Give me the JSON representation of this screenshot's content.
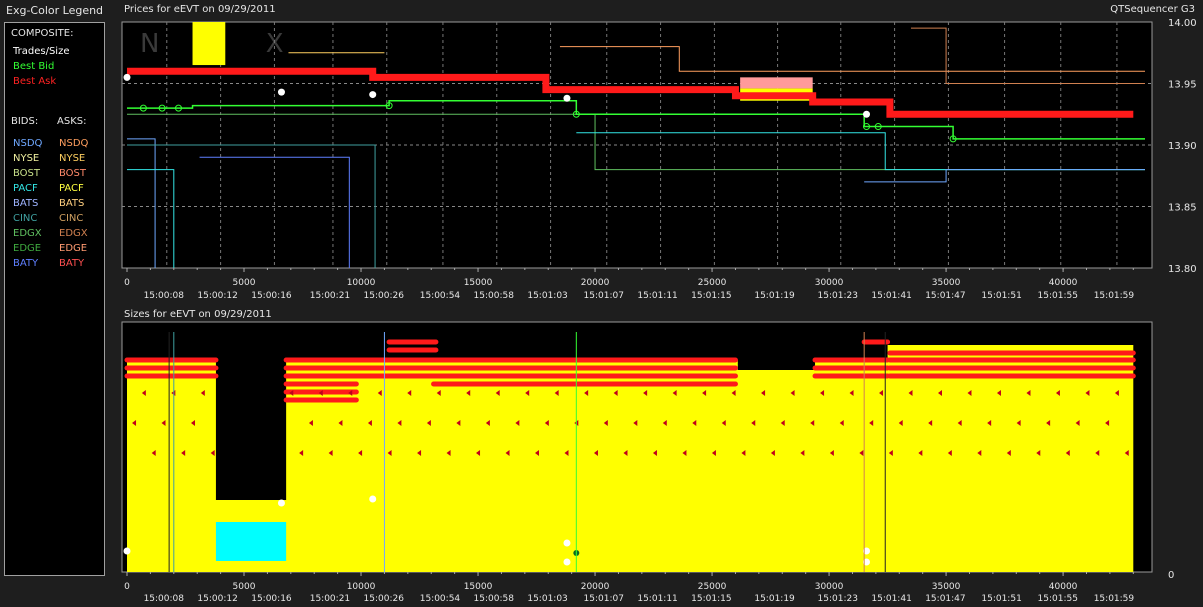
{
  "app_title": "QTSequencer G3",
  "legend": {
    "title": "Exg-Color Legend",
    "composite_header": "COMPOSITE:",
    "composite": [
      {
        "label": "Trades/Size",
        "color": "#ffffff"
      },
      {
        "label": "Best Bid",
        "color": "#33ff33"
      },
      {
        "label": "Best Ask",
        "color": "#ff2222"
      }
    ],
    "bids_header": "BIDS:",
    "asks_header": "ASKS:",
    "bids": [
      {
        "label": "NSDQ",
        "color": "#6fa8ff"
      },
      {
        "label": "NYSE",
        "color": "#f0f0a0"
      },
      {
        "label": "BOST",
        "color": "#c8e08a"
      },
      {
        "label": "PACF",
        "color": "#33e6e6"
      },
      {
        "label": "BATS",
        "color": "#9fb4ff"
      },
      {
        "label": "CINC",
        "color": "#3fa0a0"
      },
      {
        "label": "EDGX",
        "color": "#60c060"
      },
      {
        "label": "EDGE",
        "color": "#3faa3f"
      },
      {
        "label": "BATY",
        "color": "#5f7fff"
      }
    ],
    "asks": [
      {
        "label": "NSDQ",
        "color": "#ff9f5f"
      },
      {
        "label": "NYSE",
        "color": "#ffd060"
      },
      {
        "label": "BOST",
        "color": "#ff8a6a"
      },
      {
        "label": "PACF",
        "color": "#ffff40"
      },
      {
        "label": "BATS",
        "color": "#ffcf80"
      },
      {
        "label": "CINC",
        "color": "#d0a060"
      },
      {
        "label": "EDGX",
        "color": "#d08050"
      },
      {
        "label": "EDGE",
        "color": "#ff9a70"
      },
      {
        "label": "BATY",
        "color": "#ff5050"
      }
    ]
  },
  "price_chart": {
    "title": "Prices for  eEVT  on  09/29/2011",
    "watermark": "N A X",
    "ylim": [
      13.8,
      14.0
    ],
    "yticks": [
      "14.00",
      "13.95",
      "13.90",
      "13.85",
      "13.80"
    ]
  },
  "size_chart": {
    "title": "Sizes for  eEVT  on  09/29/2011",
    "yticks": [
      "0"
    ]
  },
  "chart_data": [
    {
      "type": "line",
      "title": "Prices for  eEVT  on  09/29/2011",
      "xlim": [
        0,
        43500
      ],
      "ylim": [
        13.8,
        14.0
      ],
      "x_ticks": [
        0,
        5000,
        10000,
        15000,
        20000,
        25000,
        30000,
        35000,
        40000
      ],
      "time_labels": [
        {
          "x": 1700,
          "t": "15:00:08"
        },
        {
          "x": 4000,
          "t": "15:00:12"
        },
        {
          "x": 6300,
          "t": "15:00:16"
        },
        {
          "x": 8800,
          "t": "15:00:21"
        },
        {
          "x": 11100,
          "t": "15:00:26"
        },
        {
          "x": 13500,
          "t": "15:00:54"
        },
        {
          "x": 15800,
          "t": "15:00:58"
        },
        {
          "x": 18100,
          "t": "15:01:03"
        },
        {
          "x": 20500,
          "t": "15:01:07"
        },
        {
          "x": 22800,
          "t": "15:01:11"
        },
        {
          "x": 25100,
          "t": "15:01:15"
        },
        {
          "x": 27800,
          "t": "15:01:19"
        },
        {
          "x": 30500,
          "t": "15:01:23"
        },
        {
          "x": 32800,
          "t": "15:01:41"
        },
        {
          "x": 35100,
          "t": "15:01:47"
        },
        {
          "x": 37500,
          "t": "15:01:51"
        },
        {
          "x": 39900,
          "t": "15:01:55"
        },
        {
          "x": 42300,
          "t": "15:01:59"
        }
      ],
      "series": [
        {
          "name": "Best Ask",
          "color": "#ff1a1a",
          "points": [
            [
              0,
              13.96
            ],
            [
              1800,
              13.96
            ],
            [
              1800,
              13.96
            ],
            [
              6800,
              13.96
            ],
            [
              6800,
              13.96
            ],
            [
              10500,
              13.96
            ],
            [
              10500,
              13.955
            ],
            [
              17900,
              13.955
            ],
            [
              17900,
              13.945
            ],
            [
              26000,
              13.945
            ],
            [
              26000,
              13.94
            ],
            [
              29300,
              13.94
            ],
            [
              29300,
              13.935
            ],
            [
              32600,
              13.935
            ],
            [
              32600,
              13.925
            ],
            [
              43000,
              13.925
            ]
          ]
        },
        {
          "name": "Best Bid",
          "color": "#33ff33",
          "points": [
            [
              0,
              13.93
            ],
            [
              2800,
              13.93
            ],
            [
              2800,
              13.932
            ],
            [
              11200,
              13.932
            ],
            [
              11200,
              13.936
            ],
            [
              19200,
              13.936
            ],
            [
              19200,
              13.925
            ],
            [
              31500,
              13.925
            ],
            [
              31500,
              13.915
            ],
            [
              35300,
              13.915
            ],
            [
              35300,
              13.905
            ],
            [
              43500,
              13.905
            ]
          ]
        }
      ],
      "trades": [
        [
          0,
          13.955
        ],
        [
          6600,
          13.943
        ],
        [
          10500,
          13.941
        ],
        [
          18800,
          13.938
        ],
        [
          31600,
          13.925
        ]
      ]
    },
    {
      "type": "area",
      "title": "Sizes for  eEVT  on  09/29/2011",
      "xlim": [
        0,
        43500
      ],
      "series": [
        {
          "name": "Trades/Size",
          "color": "#ffff00"
        },
        {
          "name": "Best Ask",
          "color": "#ff1a1a"
        },
        {
          "name": "Best Bid",
          "color": "#33ff33"
        }
      ]
    }
  ]
}
